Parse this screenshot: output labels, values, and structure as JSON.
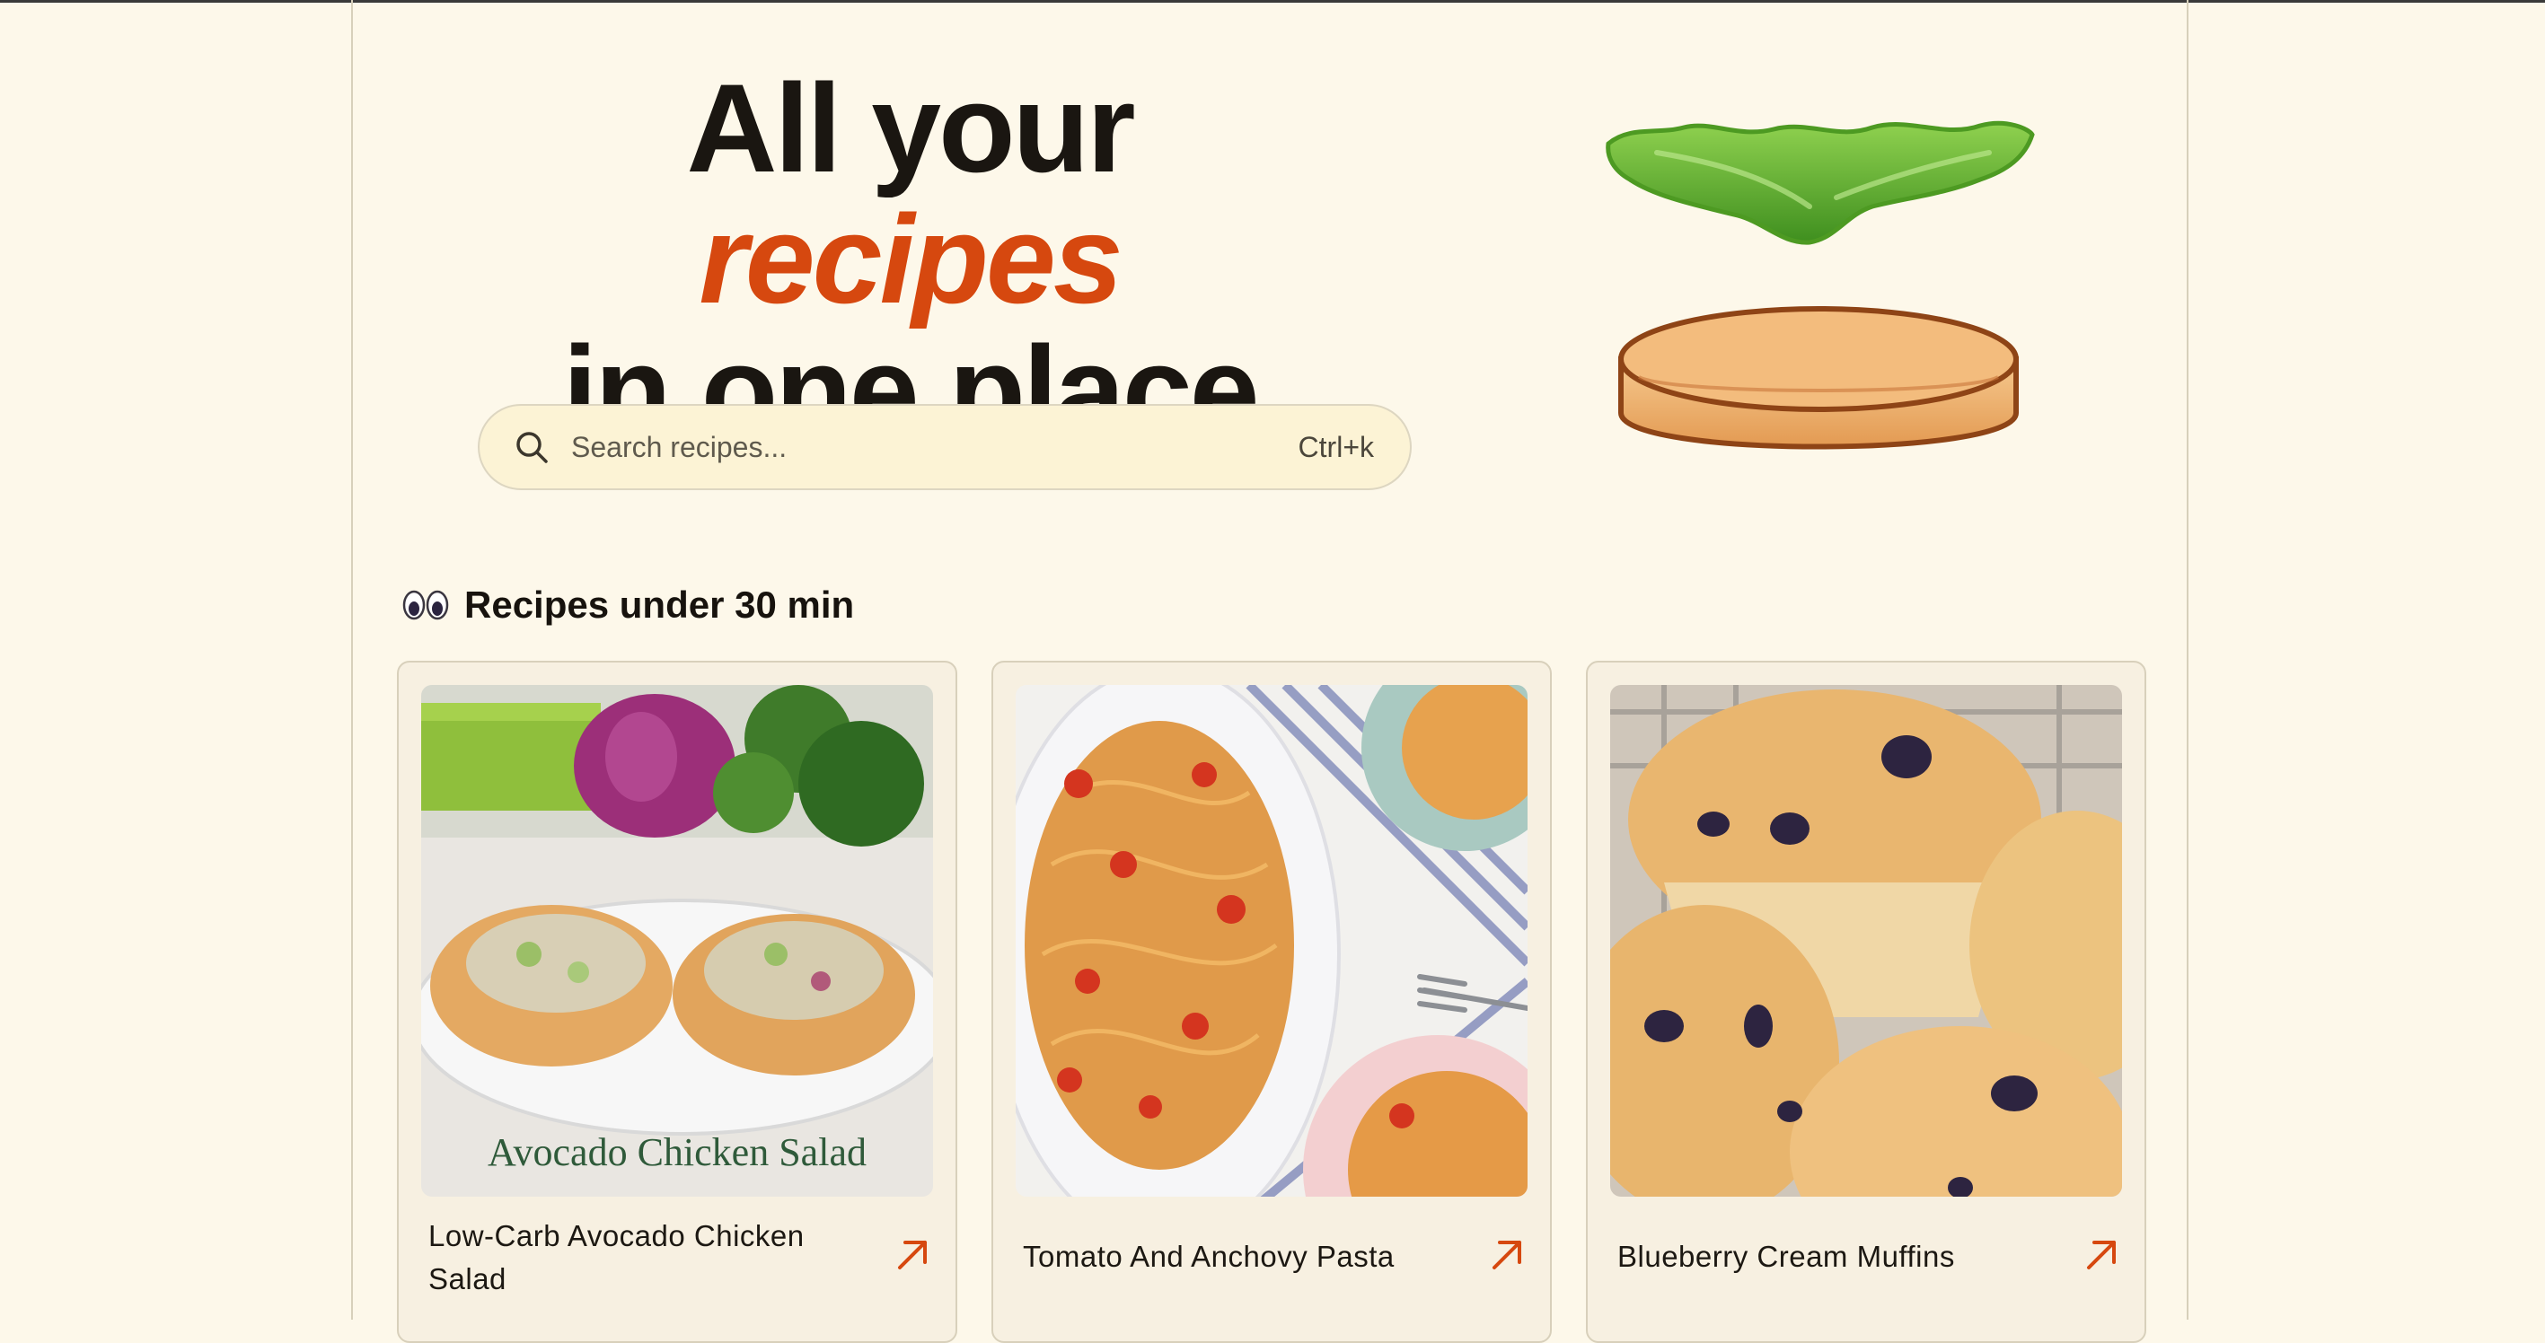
{
  "hero": {
    "title_line1_prefix": "All your",
    "title_line1_accent": "recipes",
    "title_line2": "in one place"
  },
  "search": {
    "placeholder": "Search recipes...",
    "shortcut": "Ctrl+k",
    "icon": "search-icon"
  },
  "section": {
    "icon": "eyes-emoji-icon",
    "title": "Recipes under 30 min"
  },
  "recipes": [
    {
      "name": "Low-Carb Avocado Chicken Salad",
      "image_caption": "Avocado Chicken Salad",
      "icon": "arrow-up-right-icon"
    },
    {
      "name": "Tomato And Anchovy Pasta",
      "icon": "arrow-up-right-icon"
    },
    {
      "name": "Blueberry Cream Muffins",
      "icon": "arrow-up-right-icon"
    }
  ],
  "colors": {
    "background": "#fdf8ea",
    "accent": "#d6480f",
    "search_bg": "#fcf3d5",
    "card_bg": "#f7f0e1"
  }
}
